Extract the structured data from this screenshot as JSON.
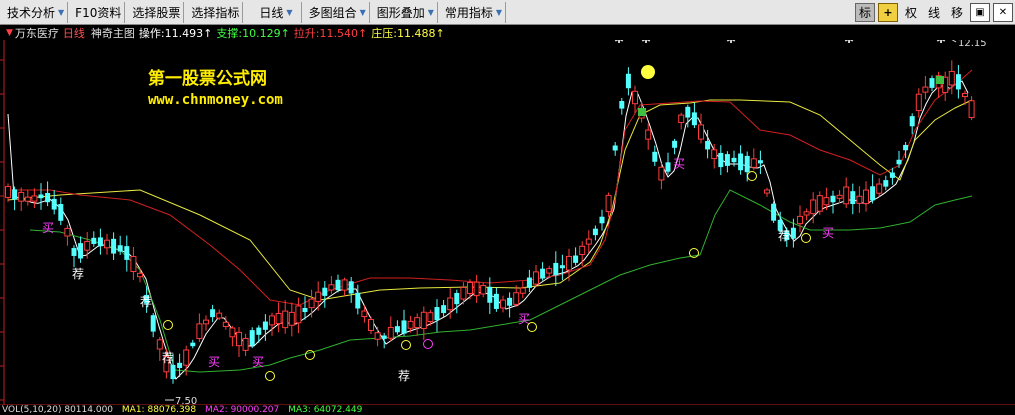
{
  "toolbar": {
    "items": [
      "技术分析",
      "F10资料",
      "选择股票",
      "选择指标",
      "日线",
      "多图组合",
      "图形叠加",
      "常用指标"
    ],
    "right_buttons": [
      "标",
      "+",
      "权",
      "线",
      "移"
    ]
  },
  "info": {
    "stock_name": "万东医疗",
    "period": "日线",
    "indicator_name": "神奇主图",
    "caozuo_label": "操作:",
    "caozuo_value": "11.493",
    "zhicheng_label": "支撑:",
    "zhicheng_value": "10.129",
    "lasheng_label": "拉升:",
    "lasheng_value": "11.540",
    "zhuangya_label": "庄压:",
    "zhuangya_value": "11.488"
  },
  "watermark": {
    "line1": "第一股票公式网",
    "line2": "www.chnmoney.com"
  },
  "annotations": {
    "high_price": "12.15",
    "low_price": "7.50"
  },
  "signals": {
    "buy": "买",
    "recommend": "荐"
  },
  "volume": {
    "label": "VOL(5,10,20)",
    "vol_value": "80114.000",
    "ma1_label": "MA1:",
    "ma1_value": "88076.398",
    "ma2_label": "MA2:",
    "ma2_value": "90000.207",
    "ma3_label": "MA3:",
    "ma3_value": "64072.449"
  },
  "colors": {
    "up": "#ff3c3c",
    "down": "#54ffff",
    "ma_white": "#ffffff",
    "ma_yellow": "#e8e840",
    "ma_red": "#d02020",
    "ma_green": "#30b030",
    "signal_magenta": "#ff40ff",
    "signal_white": "#ffffff"
  }
}
